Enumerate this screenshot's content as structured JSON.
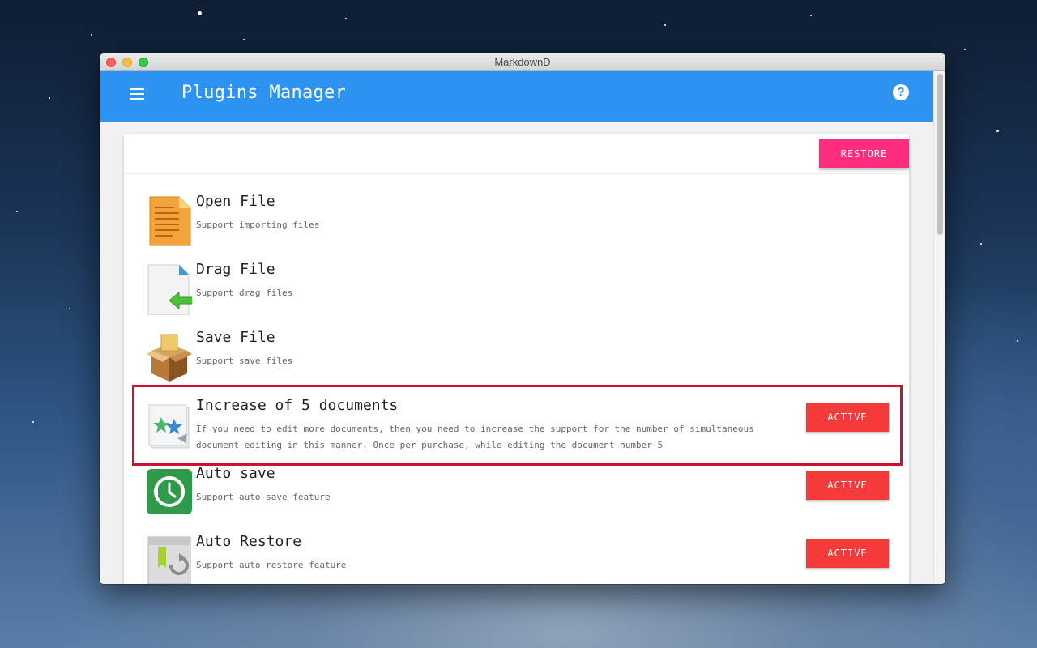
{
  "window": {
    "title": "MarkdownD"
  },
  "appbar": {
    "title": "Plugins Manager",
    "menu_icon": "menu-icon",
    "help_icon": "help-icon",
    "help_glyph": "?"
  },
  "toolbar": {
    "restore_label": "RESTORE"
  },
  "plugins": [
    {
      "name": "Open File",
      "description": "Support importing files",
      "icon": "open-file-icon",
      "action": ""
    },
    {
      "name": "Drag File",
      "description": "Support drag files",
      "icon": "drag-file-icon",
      "action": ""
    },
    {
      "name": "Save File",
      "description": "Support save files",
      "icon": "save-file-box-icon",
      "action": ""
    },
    {
      "name": "Increase of 5 documents",
      "description": "If you need to edit more documents, then you need to increase the support for the number of simultaneous document editing in this manner. Once per purchase, while editing the document number 5",
      "icon": "documents-star-icon",
      "action": "ACTIVE",
      "highlighted": true
    },
    {
      "name": "Auto save",
      "description": "Support auto save feature",
      "icon": "time-machine-icon",
      "action": "ACTIVE"
    },
    {
      "name": "Auto Restore",
      "description": "Support auto restore feature",
      "icon": "restore-recycle-icon",
      "action": "ACTIVE"
    }
  ],
  "colors": {
    "appbar": "#2d93f0",
    "restore_button": "#ff2d7f",
    "active_button": "#f43a3a",
    "highlight_border": "#d0112b"
  }
}
